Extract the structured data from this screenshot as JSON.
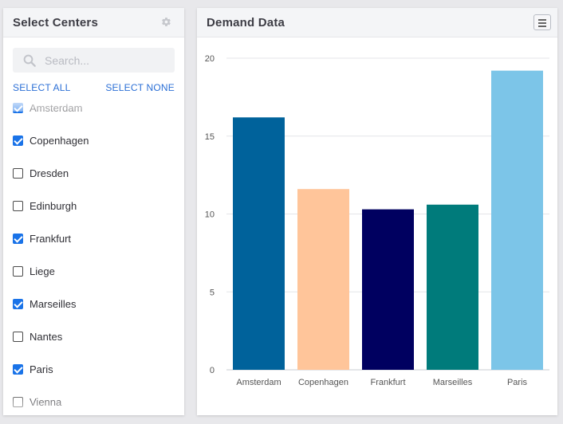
{
  "left_panel": {
    "title": "Select Centers",
    "settings_icon": "gear-icon",
    "search": {
      "placeholder": "Search...",
      "value": "",
      "icon": "search-icon"
    },
    "select_all": "SELECT ALL",
    "select_none": "SELECT NONE",
    "items": [
      {
        "label": "Amsterdam",
        "checked": true
      },
      {
        "label": "Copenhagen",
        "checked": true
      },
      {
        "label": "Dresden",
        "checked": false
      },
      {
        "label": "Edinburgh",
        "checked": false
      },
      {
        "label": "Frankfurt",
        "checked": true
      },
      {
        "label": "Liege",
        "checked": false
      },
      {
        "label": "Marseilles",
        "checked": true
      },
      {
        "label": "Nantes",
        "checked": false
      },
      {
        "label": "Paris",
        "checked": true
      },
      {
        "label": "Vienna",
        "checked": false
      }
    ]
  },
  "right_panel": {
    "title": "Demand Data",
    "menu_icon": "hamburger-menu-icon"
  },
  "chart_data": {
    "type": "bar",
    "categories": [
      "Amsterdam",
      "Copenhagen",
      "Frankfurt",
      "Marseilles",
      "Paris"
    ],
    "values": [
      16.2,
      11.6,
      10.3,
      10.6,
      19.2
    ],
    "colors": [
      "#00629b",
      "#ffc59a",
      "#000060",
      "#007b7b",
      "#7cc5e8"
    ],
    "title": "",
    "xlabel": "",
    "ylabel": "",
    "ylim": [
      0,
      20
    ],
    "yticks": [
      "0",
      "5",
      "10",
      "15",
      "20"
    ],
    "grid": true,
    "legend": "none"
  }
}
